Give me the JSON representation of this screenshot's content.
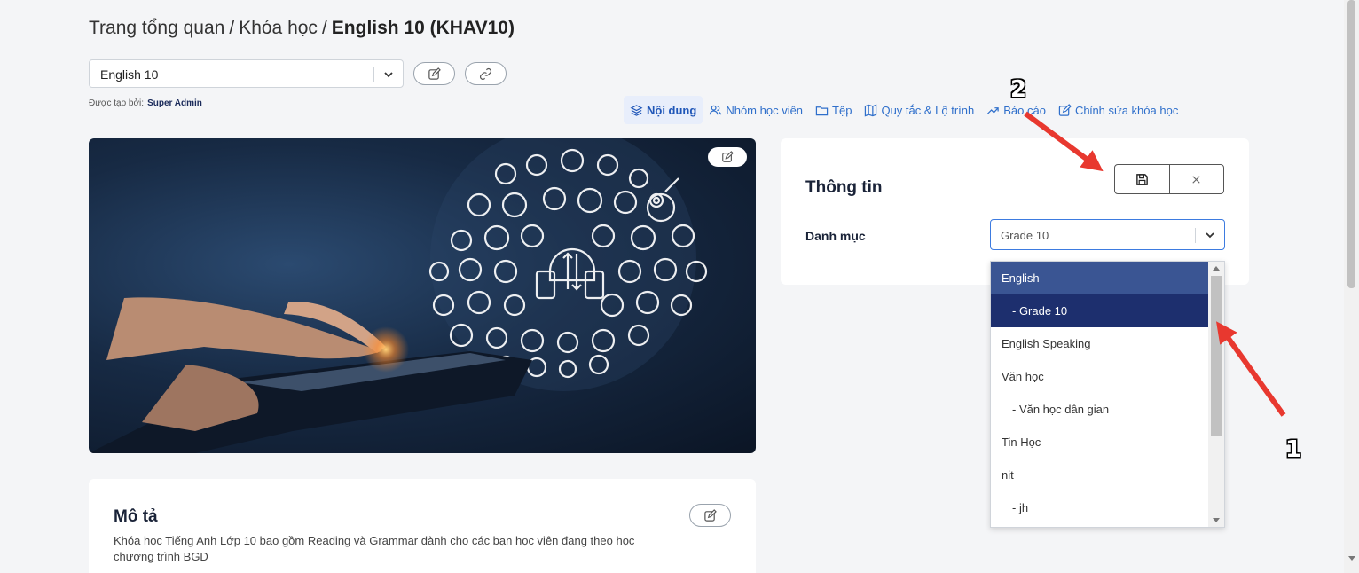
{
  "breadcrumb": {
    "home": "Trang tổng quan",
    "separator": "/",
    "courses": "Khóa học",
    "current": "English 10 (KHAV10)"
  },
  "course_selector": {
    "value": "English 10"
  },
  "created_by": {
    "label": "Được tạo bởi:",
    "name": "Super Admin"
  },
  "tabs": [
    {
      "label": "Nội dung",
      "icon": "layers-icon",
      "active": true
    },
    {
      "label": "Nhóm học viên",
      "icon": "users-icon",
      "active": false
    },
    {
      "label": "Tệp",
      "icon": "folder-icon",
      "active": false
    },
    {
      "label": "Quy tắc & Lộ trình",
      "icon": "map-icon",
      "active": false
    },
    {
      "label": "Báo cáo",
      "icon": "trending-up-icon",
      "active": false
    },
    {
      "label": "Chỉnh sửa khóa học",
      "icon": "edit-icon",
      "active": false
    }
  ],
  "info_panel": {
    "title": "Thông tin",
    "category_label": "Danh mục",
    "category_value": "Grade 10"
  },
  "category_options": [
    {
      "label": "English",
      "indent": false,
      "state": "hover"
    },
    {
      "label": "- Grade 10",
      "indent": true,
      "state": "selected"
    },
    {
      "label": "English Speaking",
      "indent": false,
      "state": ""
    },
    {
      "label": "Văn học",
      "indent": false,
      "state": ""
    },
    {
      "label": "- Văn học dân gian",
      "indent": true,
      "state": ""
    },
    {
      "label": "Tin Học",
      "indent": false,
      "state": ""
    },
    {
      "label": "nit",
      "indent": false,
      "state": ""
    },
    {
      "label": "- jh",
      "indent": true,
      "state": ""
    }
  ],
  "description": {
    "title": "Mô tả",
    "text_line1": "Khóa học Tiếng Anh Lớp 10 bao gồm Reading và Grammar dành cho các bạn học viên đang theo học",
    "text_line2": "chương trình BGD"
  },
  "annotations": {
    "one": "1",
    "two": "2"
  },
  "colors": {
    "accent": "#2f6fcb",
    "selected_bg": "#1d2f6e",
    "hover_bg": "#3a5593",
    "arrow": "#e8382f"
  }
}
